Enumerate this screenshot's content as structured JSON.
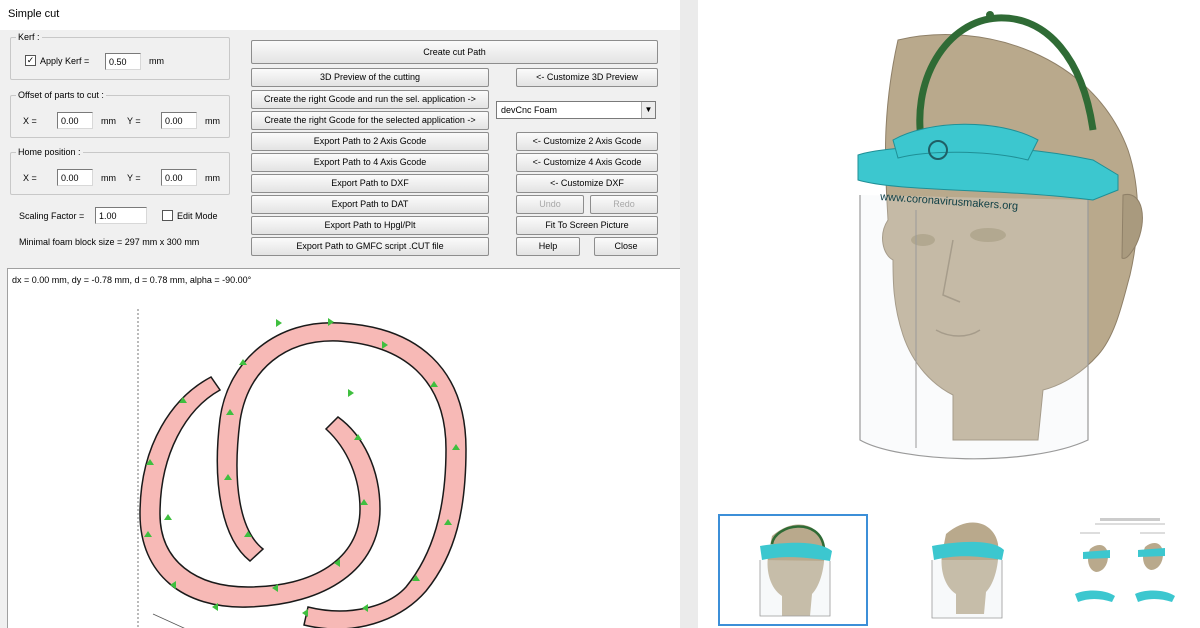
{
  "window": {
    "title": "Simple cut"
  },
  "kerf": {
    "group_label": "Kerf :",
    "apply_label": "Apply Kerf =",
    "apply_checked": true,
    "check_glyph": "✓",
    "value": "0.50",
    "unit": "mm"
  },
  "offset": {
    "group_label": "Offset of parts to cut :",
    "x_label": "X =",
    "x_value": "0.00",
    "x_unit": "mm",
    "y_label": "Y =",
    "y_value": "0.00",
    "y_unit": "mm"
  },
  "home": {
    "group_label": "Home position :",
    "x_label": "X =",
    "x_value": "0.00",
    "x_unit": "mm",
    "y_label": "Y =",
    "y_value": "0.00",
    "y_unit": "mm"
  },
  "scaling": {
    "label": "Scaling Factor =",
    "value": "1.00"
  },
  "edit_mode": {
    "label": "Edit Mode",
    "checked": false
  },
  "foam_info": "Minimal foam block size = 297 mm x 300 mm",
  "buttons": {
    "create_cut_path": "Create cut Path",
    "preview_3d": "3D Preview of the cutting",
    "create_gcode_run": "Create the right Gcode and run the sel. application ->",
    "create_gcode_selected": "Create the right Gcode for the selected application ->",
    "export_2axis": "Export Path to 2 Axis Gcode",
    "export_4axis": "Export Path to 4 Axis Gcode",
    "export_dxf": "Export Path to DXF",
    "export_dat": "Export Path to DAT",
    "export_hpgl": "Export Path to Hpgl/Plt",
    "export_gmfc": "Export Path to GMFC script .CUT file",
    "customize_3d": "<- Customize 3D Preview",
    "customize_2axis": "<- Customize 2 Axis Gcode",
    "customize_4axis": "<- Customize 4 Axis Gcode",
    "customize_dxf": "<- Customize DXF",
    "undo": "Undo",
    "redo": "Redo",
    "fit_screen": "Fit To Screen Picture",
    "help": "Help",
    "close": "Close"
  },
  "application_select": {
    "value": "devCnc Foam",
    "arrow": "▼"
  },
  "canvas": {
    "readout": "dx = 0.00 mm, dy = -0.78 mm, d = 0.78 mm, alpha = -90.00°",
    "colors": {
      "shape_fill": "#f7b9b6",
      "outline": "#1a1a1a",
      "direction_arrows": "#3fbf3f",
      "guide_line": "#555555"
    }
  },
  "viewer": {
    "visor_text": "www.coronavirusmakers.org",
    "colors": {
      "head": "#b9a98c",
      "visor": "#3cc7cf",
      "strap": "#2f6b35",
      "shield": "#9a9a9a",
      "selected_thumb": "#3c8fd8"
    },
    "thumbnails": [
      {
        "name": "front-view",
        "selected": true
      },
      {
        "name": "side-view",
        "selected": false
      },
      {
        "name": "instruction-sheet",
        "selected": false
      }
    ]
  }
}
